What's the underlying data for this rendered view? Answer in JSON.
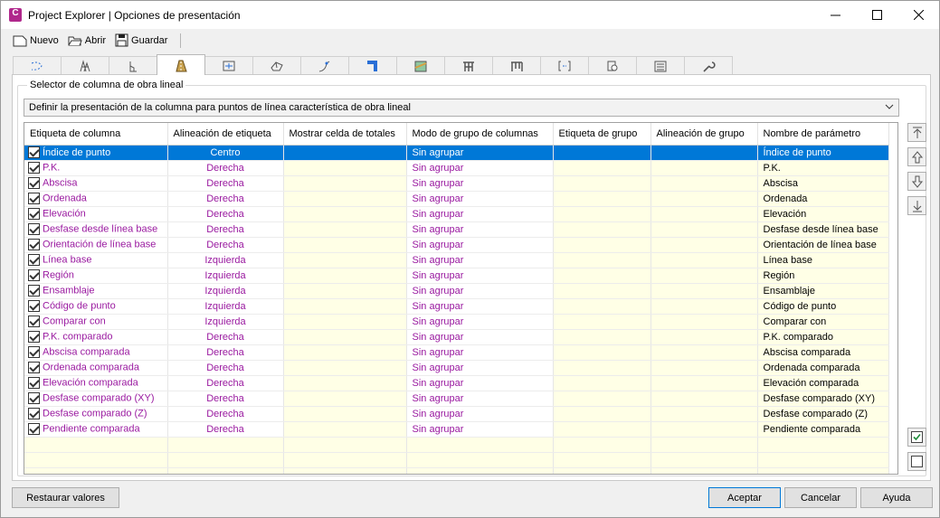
{
  "window": {
    "title": "Project Explorer | Opciones de presentación",
    "app_icon_letter": "C"
  },
  "toolbar": {
    "new_label": "Nuevo",
    "open_label": "Abrir",
    "save_label": "Guardar"
  },
  "group": {
    "label": "Selector de columna de obra lineal"
  },
  "selector": {
    "value": "Definir la presentación de la columna para puntos de línea característica de obra lineal"
  },
  "table": {
    "headers": [
      "Etiqueta de columna",
      "Alineación de etiqueta",
      "Mostrar celda de totales",
      "Modo de grupo de columnas",
      "Etiqueta de grupo",
      "Alineación de grupo",
      "Nombre de parámetro"
    ],
    "rows": [
      {
        "label": "Índice de punto",
        "align": "Centro",
        "mode": "Sin agrupar",
        "param": "Índice de punto",
        "checked": true
      },
      {
        "label": "P.K.",
        "align": "Derecha",
        "mode": "Sin agrupar",
        "param": "P.K.",
        "checked": true
      },
      {
        "label": "Abscisa",
        "align": "Derecha",
        "mode": "Sin agrupar",
        "param": "Abscisa",
        "checked": true
      },
      {
        "label": "Ordenada",
        "align": "Derecha",
        "mode": "Sin agrupar",
        "param": "Ordenada",
        "checked": true
      },
      {
        "label": "Elevación",
        "align": "Derecha",
        "mode": "Sin agrupar",
        "param": "Elevación",
        "checked": true
      },
      {
        "label": "Desfase desde línea base",
        "align": "Derecha",
        "mode": "Sin agrupar",
        "param": "Desfase desde línea base",
        "checked": true
      },
      {
        "label": "Orientación de línea base",
        "align": "Derecha",
        "mode": "Sin agrupar",
        "param": "Orientación de línea base",
        "checked": true
      },
      {
        "label": "Línea base",
        "align": "Izquierda",
        "mode": "Sin agrupar",
        "param": "Línea base",
        "checked": true
      },
      {
        "label": "Región",
        "align": "Izquierda",
        "mode": "Sin agrupar",
        "param": "Región",
        "checked": true
      },
      {
        "label": "Ensamblaje",
        "align": "Izquierda",
        "mode": "Sin agrupar",
        "param": "Ensamblaje",
        "checked": true
      },
      {
        "label": "Código de punto",
        "align": "Izquierda",
        "mode": "Sin agrupar",
        "param": "Código de punto",
        "checked": true
      },
      {
        "label": "Comparar con",
        "align": "Izquierda",
        "mode": "Sin agrupar",
        "param": "Comparar con",
        "checked": true
      },
      {
        "label": "P.K. comparado",
        "align": "Derecha",
        "mode": "Sin agrupar",
        "param": "P.K. comparado",
        "checked": true
      },
      {
        "label": "Abscisa comparada",
        "align": "Derecha",
        "mode": "Sin agrupar",
        "param": "Abscisa comparada",
        "checked": true
      },
      {
        "label": "Ordenada comparada",
        "align": "Derecha",
        "mode": "Sin agrupar",
        "param": "Ordenada comparada",
        "checked": true
      },
      {
        "label": "Elevación comparada",
        "align": "Derecha",
        "mode": "Sin agrupar",
        "param": "Elevación comparada",
        "checked": true
      },
      {
        "label": "Desfase comparado (XY)",
        "align": "Derecha",
        "mode": "Sin agrupar",
        "param": "Desfase comparado (XY)",
        "checked": true
      },
      {
        "label": "Desfase comparado (Z)",
        "align": "Derecha",
        "mode": "Sin agrupar",
        "param": "Desfase comparado (Z)",
        "checked": true
      },
      {
        "label": "Pendiente comparada",
        "align": "Derecha",
        "mode": "Sin agrupar",
        "param": "Pendiente comparada",
        "checked": true
      }
    ],
    "selected_row": 0
  },
  "footer": {
    "restore_label": "Restaurar valores",
    "ok_label": "Aceptar",
    "cancel_label": "Cancelar",
    "help_label": "Ayuda"
  },
  "colors": {
    "selection": "#0078d7",
    "cell_text": "#9a1aa0",
    "cell_background": "#ffffe6"
  }
}
